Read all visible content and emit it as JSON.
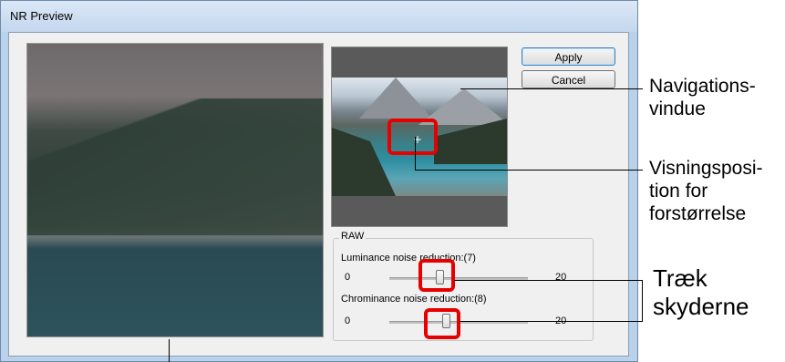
{
  "window": {
    "title": "NR Preview"
  },
  "buttons": {
    "apply": "Apply",
    "cancel": "Cancel"
  },
  "raw_group": {
    "label": "RAW",
    "luminance": {
      "label": "Luminance noise reduction:(7)",
      "min": "0",
      "max": "20",
      "value": 7
    },
    "chrominance": {
      "label": "Chrominance noise reduction:(8)",
      "min": "0",
      "max": "20",
      "value": 8
    }
  },
  "navigator": {
    "crosshair": "+"
  },
  "callouts": {
    "navigation_window": {
      "line1": "Navigations-",
      "line2": "vindue"
    },
    "display_position": {
      "line1": "Visningsposi-",
      "line2": "tion for",
      "line3": "forstørrelse"
    },
    "drag_sliders": {
      "line1": "Træk",
      "line2": "skyderne"
    }
  },
  "colors": {
    "highlight": "#e60000",
    "title_bar": "#c3d7ee",
    "dialog_bg": "#f0f0f0"
  }
}
